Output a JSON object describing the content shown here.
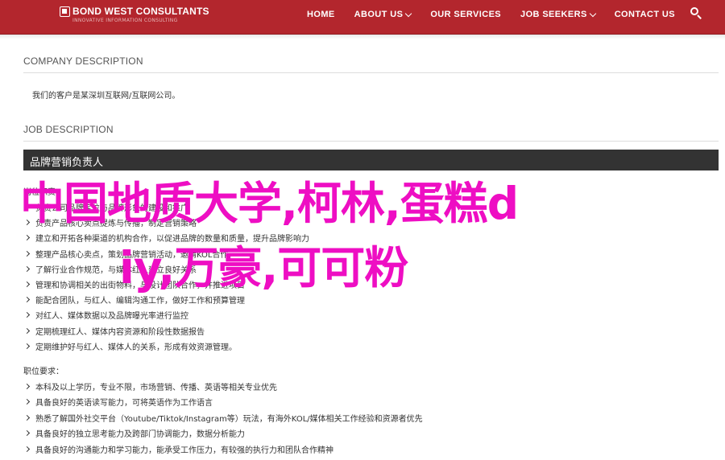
{
  "header": {
    "logo_text": "BOND WEST CONSULTANTS",
    "tagline": "INNOVATIVE INFORMATION CONSULTING",
    "nav": [
      "HOME",
      "ABOUT US",
      "OUR SERVICES",
      "JOB SEEKERS",
      "CONTACT US"
    ],
    "search_icon": "search-icon"
  },
  "company": {
    "heading": "COMPANY DESCRIPTION",
    "text": "我们的客户是某深圳互联网/互联网公司。"
  },
  "job": {
    "heading": "JOB DESCRIPTION",
    "title": "品牌营销负责人",
    "duties_label": "岗位职责：",
    "duties": [
      "负责公司品牌定位与品牌形象的建设和推广",
      "负责产品核心卖点提炼与传播，制定营销策略",
      "建立和开拓各种渠道的机构合作，以促进品牌的数量和质量，提升品牌影响力",
      "整理产品核心卖点，策划品牌营销活动，邀请KOL合作",
      "了解行业合作规范，与媒体红人建立良好关系",
      "管理和协调相关的出街物料，与设计团队合作，并推进项目",
      "能配合团队，与红人、编辑沟通工作，做好工作和预算管理",
      "对红人、媒体数据以及品牌曝光率进行监控",
      "定期梳理红人、媒体内容资源和阶段性数据报告",
      "定期维护好与红人、媒体人的关系，形成有效资源管理。"
    ],
    "req_label": "职位要求：",
    "requirements": [
      "本科及以上学历，专业不限，市场营销、传播、英语等相关专业优先",
      "具备良好的英语读写能力，可将英语作为工作语言",
      "熟悉了解国外社交平台（Youtube/Tiktok/Instagram等）玩法，有海外KOL/媒体相关工作经验和资源者优先",
      "具备良好的独立思考能力及跨部门协调能力，数据分析能力",
      "具备良好的沟通能力和学习能力，能承受工作压力，有较强的执行力和团队合作精神"
    ]
  },
  "overlay": {
    "line1": "中国地质大学,柯林,蛋糕d",
    "line2": "iy,万豪,可可粉",
    "color": "#ee0ec3"
  },
  "colors": {
    "brand": "#b3262d",
    "title_bar": "#333333"
  }
}
